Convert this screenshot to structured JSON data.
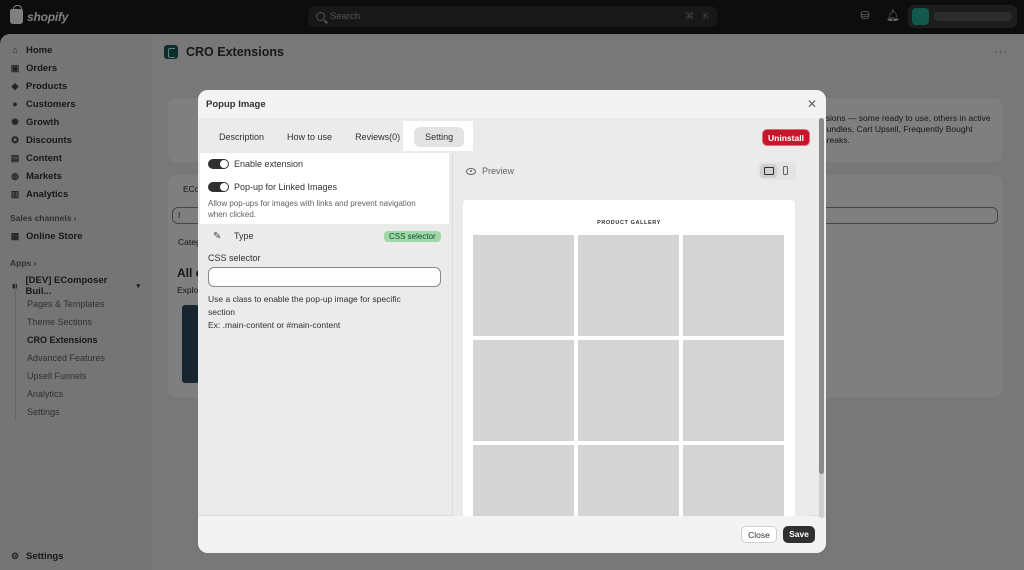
{
  "topbar": {
    "brand": "shopify",
    "search_placeholder": "Search",
    "shortcut_1": "⌘",
    "shortcut_2": "K"
  },
  "sidebar": {
    "items": [
      {
        "label": "Home",
        "icon": "home-icon"
      },
      {
        "label": "Orders",
        "icon": "orders-icon"
      },
      {
        "label": "Products",
        "icon": "tag-icon"
      },
      {
        "label": "Customers",
        "icon": "person-icon"
      },
      {
        "label": "Growth",
        "icon": "growth-icon"
      },
      {
        "label": "Discounts",
        "icon": "discount-icon"
      },
      {
        "label": "Content",
        "icon": "content-icon"
      },
      {
        "label": "Markets",
        "icon": "globe-icon"
      },
      {
        "label": "Analytics",
        "icon": "chart-icon"
      }
    ],
    "sales_channels_label": "Sales channels",
    "online_store": "Online Store",
    "apps_label": "Apps",
    "app_name": "[DEV] EComposer Buil...",
    "sub_items": [
      "Pages & Templates",
      "Theme Sections",
      "CRO Extensions",
      "Advanced Features",
      "Upsell Funnels",
      "Analytics",
      "Settings"
    ],
    "settings": "Settings"
  },
  "page": {
    "title": "CRO Extensions",
    "bg_text_1": "nsions — some ready to use, others in active",
    "bg_text_2": "Bundles, Cart Upsell, Frequently Bought",
    "bg_text_3": "Breaks.",
    "bg_tab": "ECo",
    "bg_search": "I",
    "bg_categ": "Categ",
    "bg_heading": "All e",
    "bg_explore": "Explo"
  },
  "modal": {
    "title": "Popup Image",
    "tabs": [
      "Description",
      "How to use",
      "Reviews(0)",
      "Setting"
    ],
    "active_tab": "Setting",
    "uninstall": "Uninstall",
    "enable_extension": "Enable extension",
    "linked_images": "Pop-up for Linked Images",
    "linked_help_1": "Allow pop-ups for images with links and prevent navigation",
    "linked_help_2": "when clicked.",
    "type_label": "Type",
    "type_badge": "CSS selector",
    "css_selector_label": "CSS selector",
    "css_selector_value": "",
    "css_help_1": "Use a class to enable the pop-up image for specific",
    "css_help_2": "section",
    "css_help_3": "Ex: .main-content or #main-content",
    "preview_label": "Preview",
    "gallery_title": "PRODUCT GALLERY",
    "close_button": "Close",
    "save_button": "Save"
  },
  "colors": {
    "uninstall": "#c7162b",
    "badge_bg": "#a0d8a8",
    "primary": "#303030"
  }
}
